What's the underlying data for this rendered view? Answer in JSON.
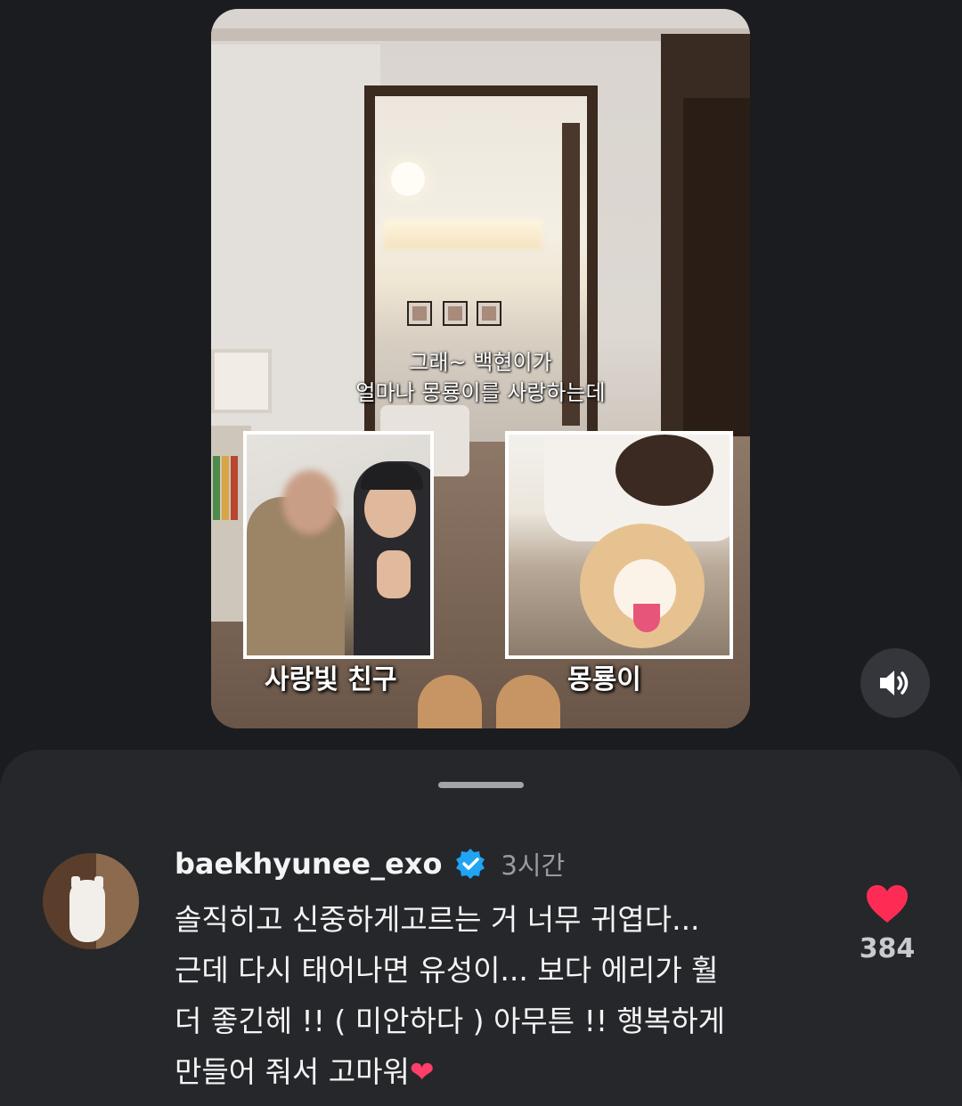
{
  "video": {
    "caption_line1": "그래~ 백현이가",
    "caption_line2": "얼마나 몽룡이를 사랑하는데",
    "label_left": "사랑빛 친구",
    "label_right": "몽룡이"
  },
  "sound_button": {
    "icon": "speaker-icon"
  },
  "comment": {
    "username": "baekhyunee_exo",
    "verified_icon": "verified-badge-icon",
    "timestamp": "3시간",
    "text": "솔직히고 신중하게고르는 거 너무 귀엽다...\n근데 다시 태어나면 유성이... 보다 에리가 훨\n더 좋긴헤 !! ( 미안하다 ) 아무튼 !! 행복하게\n만들어 줘서 고마워",
    "heart_emoji": "❤",
    "like_count": "384",
    "like_icon": "heart-icon",
    "like_color": "#fe2c55",
    "verified_color": "#20a4f3"
  }
}
